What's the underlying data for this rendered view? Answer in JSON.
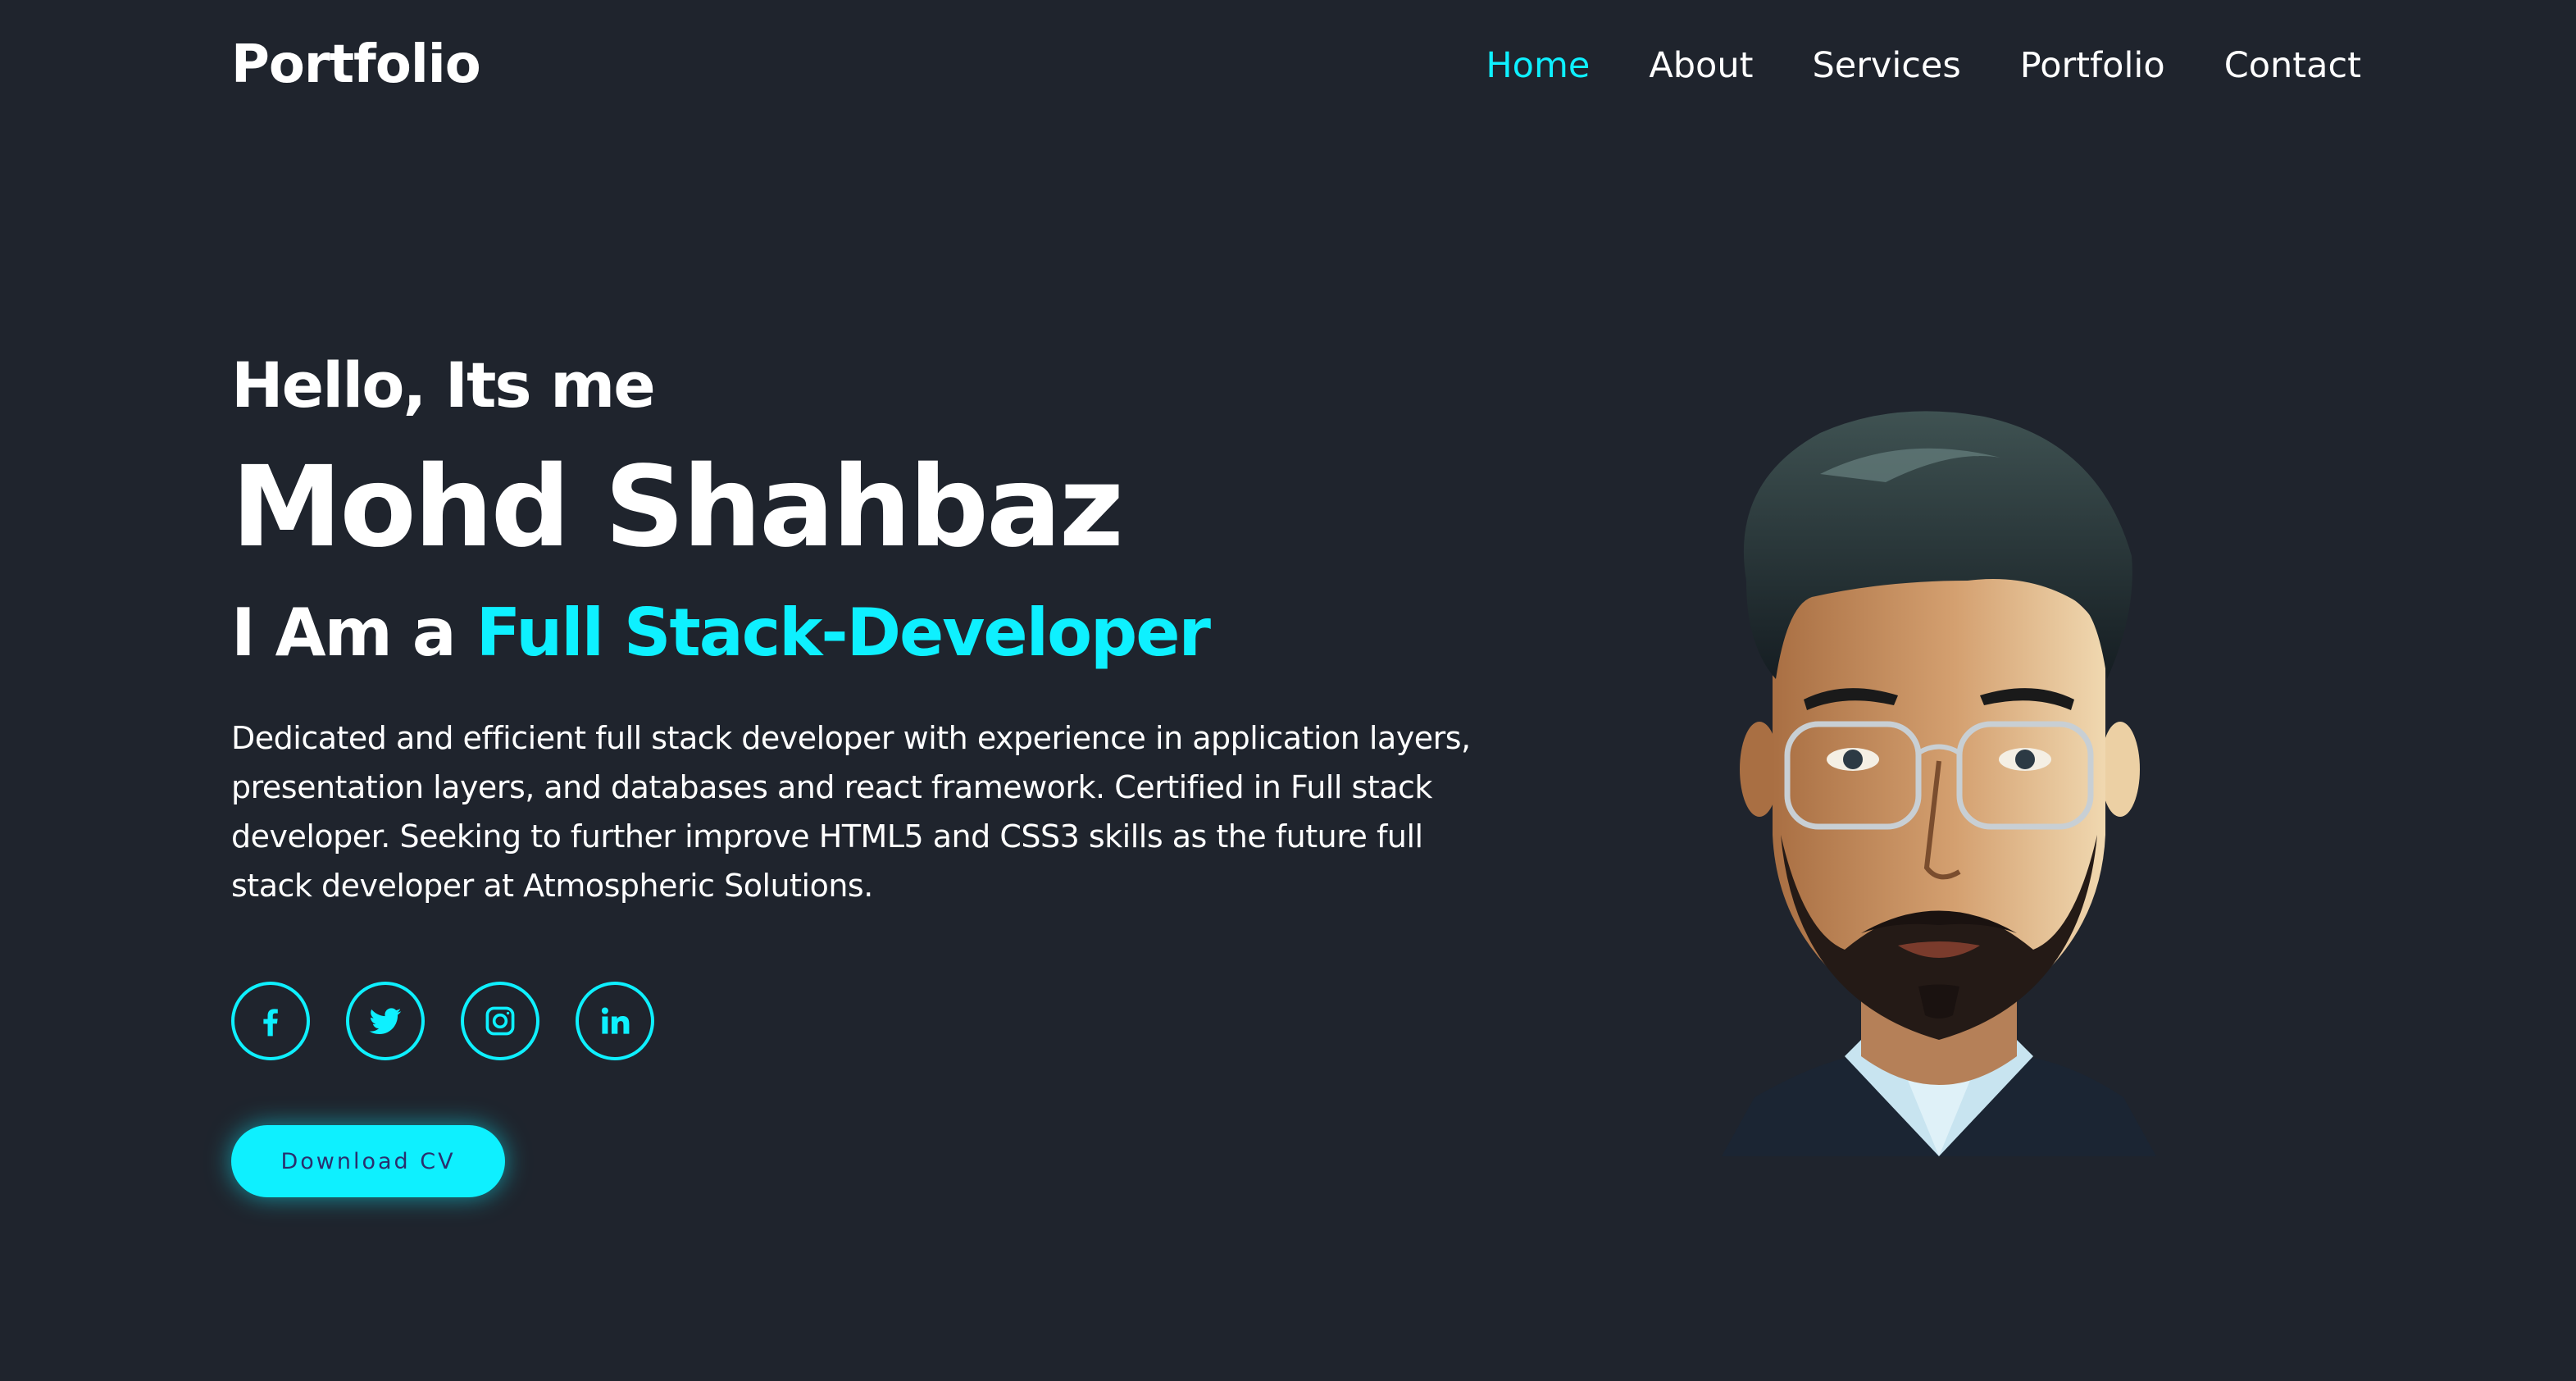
{
  "header": {
    "logo": "Portfolio",
    "nav": [
      {
        "label": "Home",
        "active": true
      },
      {
        "label": "About",
        "active": false
      },
      {
        "label": "Services",
        "active": false
      },
      {
        "label": "Portfolio",
        "active": false
      },
      {
        "label": "Contact",
        "active": false
      }
    ]
  },
  "hero": {
    "greeting": "Hello, Its me",
    "name": "Mohd Shahbaz",
    "role_prefix": "I Am a",
    "role_highlight": "Full Stack-Developer",
    "description": "Dedicated and efficient full stack developer with experience in application layers, presentation layers, and databases and react framework. Certified in Full stack developer. Seeking to further improve HTML5 and CSS3 skills as the future full stack developer at Atmospheric Solutions.",
    "socials": [
      {
        "icon": "facebook-icon"
      },
      {
        "icon": "twitter-icon"
      },
      {
        "icon": "instagram-icon"
      },
      {
        "icon": "linkedin-icon"
      }
    ],
    "cv_button": "Download CV"
  },
  "colors": {
    "background": "#1f242d",
    "accent": "#0ef0ff",
    "text": "#ffffff",
    "button_text": "#2a2f6e"
  }
}
